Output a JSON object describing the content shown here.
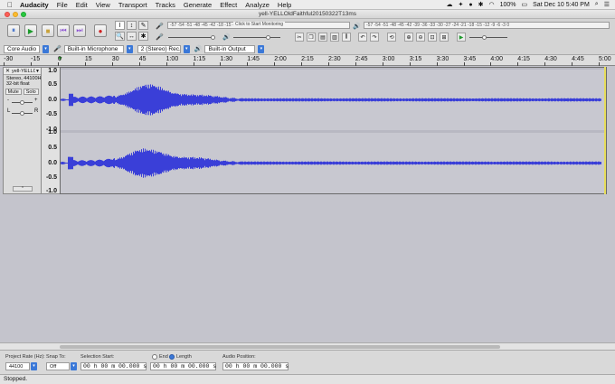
{
  "menubar": {
    "app": "Audacity",
    "items": [
      "File",
      "Edit",
      "View",
      "Transport",
      "Tracks",
      "Generate",
      "Effect",
      "Analyze",
      "Help"
    ],
    "battery": "100%",
    "clock": "Sat Dec 10  5:40 PM"
  },
  "window": {
    "title": "yell-YELLOldFaithful20150322T13ms"
  },
  "toolbar": {
    "meter_hint": "Click to Start Monitoring",
    "record_ticks": "-57 -54 -51 -48 -45 -42 -18 -15 -12 -9 -6 -3 0",
    "play_ticks": "-57 -54 -51 -48 -45 -42 -39 -36 -33 -30 -27 -24 -21 -18 -15 -12 -9 -6 -3 0",
    "icons": {
      "pause": "⏸",
      "play": "▶",
      "stop": "■",
      "skip_start": "⏮",
      "skip_end": "⏭",
      "record": "●",
      "select": "I",
      "envelope": "↕",
      "draw": "✎",
      "zoom": "🔍",
      "timeshift": "↔",
      "multi": "✱"
    }
  },
  "devices": {
    "host": "Core Audio",
    "input": "Built-in Microphone",
    "channels": "2 (Stereo) Rec...",
    "output": "Built-in Output"
  },
  "ruler": {
    "labels": [
      "-30",
      "-15",
      "0",
      "15",
      "30",
      "45",
      "1:00",
      "1:15",
      "1:30",
      "1:45",
      "2:00",
      "2:15",
      "2:30",
      "2:45",
      "3:00",
      "3:15",
      "3:30",
      "3:45",
      "4:00",
      "4:15",
      "4:30",
      "4:45",
      "5:00"
    ]
  },
  "track": {
    "name": "yell-YELLOW",
    "info1": "Stereo, 44100Hz",
    "info2": "32-bit float",
    "mute": "Mute",
    "solo": "Solo",
    "pan_left": "L",
    "pan_right": "R",
    "gain_minus": "-",
    "gain_plus": "+",
    "vlabels": [
      "1.0",
      "0.5",
      "0.0",
      "-0.5",
      "-1.0"
    ]
  },
  "colors": {
    "waveform": "#3a3fd8",
    "accent": "#3a78d8"
  },
  "selection": {
    "rate_label": "Project Rate (Hz):",
    "rate_value": "44100",
    "snap_label": "Snap To:",
    "snap_value": "Off",
    "start_label": "Selection Start:",
    "end_label": "End",
    "length_label": "Length",
    "audio_pos_label": "Audio Position:",
    "start_time": "00 h 00 m 00.000 s",
    "length_time": "00 h 00 m 00.000 s",
    "audio_time": "00 h 00 m 00.000 s"
  },
  "status": "Stopped."
}
